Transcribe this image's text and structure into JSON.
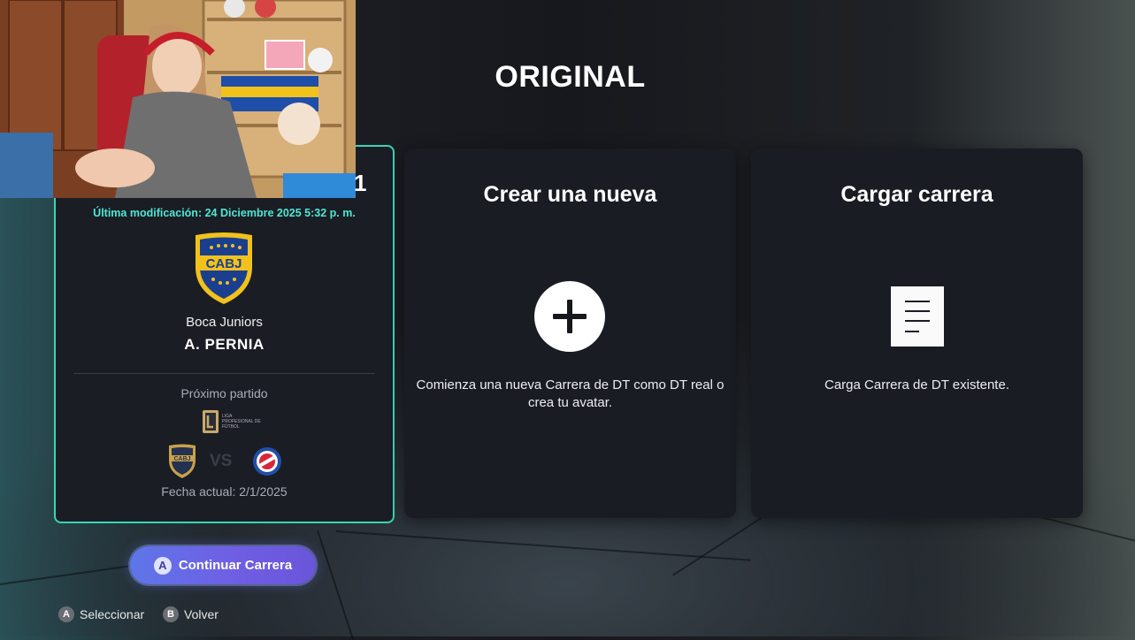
{
  "page": {
    "title": "ORIGINAL"
  },
  "save_slot": {
    "slot_number": "1",
    "last_modified": "Última modificación: 24 Diciembre 2025 5:32 p. m.",
    "team_crest_text": "CABJ",
    "team_name": "Boca Juniors",
    "manager_name": "A. PERNIA",
    "next_match_label": "Próximo partido",
    "league_logo_text": "LIGA PROFESIONAL DE FÚTBOL",
    "home_crest_text": "CABJ",
    "vs": "VS",
    "current_date": "Fecha actual: 2/1/2025"
  },
  "cards": {
    "new": {
      "title": "Crear una nueva",
      "description": "Comienza una nueva Carrera de DT como DT real o crea tu avatar.",
      "icon": "plus-icon"
    },
    "load": {
      "title": "Cargar carrera",
      "description": "Carga Carrera de DT existente.",
      "icon": "document-icon"
    }
  },
  "actions": {
    "continue_button_glyph": "A",
    "continue_label": "Continuar Carrera"
  },
  "hints": {
    "select_glyph": "A",
    "select_label": "Seleccionar",
    "back_glyph": "B",
    "back_label": "Volver"
  },
  "colors": {
    "accent_teal": "#38d6b4",
    "modified_text": "#4ee7d2",
    "button_purple": "#6f5fe3",
    "boca_blue": "#1b3f8f",
    "boca_gold": "#f1c21b"
  }
}
